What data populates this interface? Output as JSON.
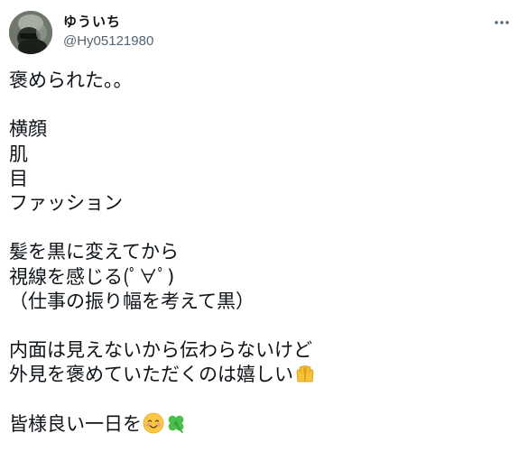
{
  "user": {
    "display_name": "ゆういち",
    "handle": "@Hy05121980"
  },
  "tweet": {
    "lines": [
      "褒められた。。",
      "",
      "横顔",
      "肌",
      "目",
      "ファッション",
      "",
      "髪を黒に変えてから",
      "視線を感じる(ﾟ∀ﾟ)",
      "（仕事の振り幅を考えて黒）",
      "",
      "内面は見えないから伝わらないけど",
      "外見を褒めていただくのは嬉しい",
      "",
      "皆様良い一日を"
    ]
  },
  "icons": {
    "more": "more-horizontal-icon",
    "emoji_raised_hands": "raising-hands-emoji",
    "emoji_smiling": "smiling-face-emoji",
    "emoji_clover": "four-leaf-clover-emoji"
  },
  "colors": {
    "text": "#0f1419",
    "secondary": "#536471",
    "hands": "#f7c236",
    "smile_face": "#f9c846",
    "blush": "#f28b9a",
    "clover": "#4bbf4b"
  }
}
